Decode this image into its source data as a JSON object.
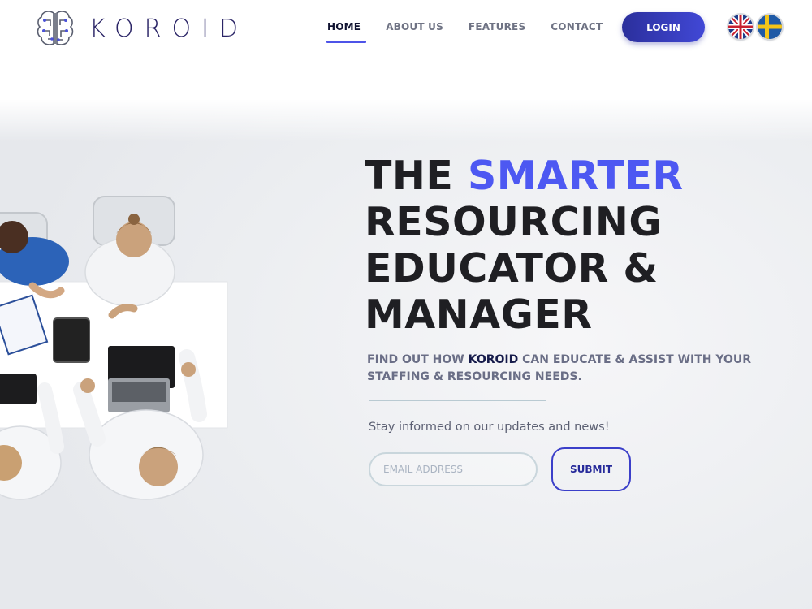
{
  "brand": {
    "name": "KOROID",
    "logo_icon": "brain-circuit-icon",
    "color": "#2a2466"
  },
  "nav": {
    "items": [
      {
        "label": "HOME",
        "active": true
      },
      {
        "label": "ABOUT US",
        "active": false
      },
      {
        "label": "FEATURES",
        "active": false
      },
      {
        "label": "CONTACT",
        "active": false
      }
    ],
    "accent": "#4e54e8"
  },
  "login": {
    "label": "LOGIN"
  },
  "languages": [
    {
      "code": "en",
      "icon": "uk-flag-icon"
    },
    {
      "code": "sv",
      "icon": "sweden-flag-icon"
    }
  ],
  "hero": {
    "headline": {
      "line1_prefix": "THE ",
      "line1_accent": "SMARTER",
      "line2": "RESOURCING",
      "line3": "EDUCATOR &",
      "line4": "MANAGER"
    },
    "accent_color": "#4d58f2",
    "subhead": {
      "prefix": "FIND OUT HOW ",
      "brand": "KOROID",
      "suffix": " CAN EDUCATE & ASSIST WITH YOUR STAFFING & RESOURCING NEEDS."
    }
  },
  "newsletter": {
    "prompt": "Stay informed on our updates and news!",
    "email_placeholder": "EMAIL ADDRESS",
    "submit_label": "SUBMIT"
  }
}
